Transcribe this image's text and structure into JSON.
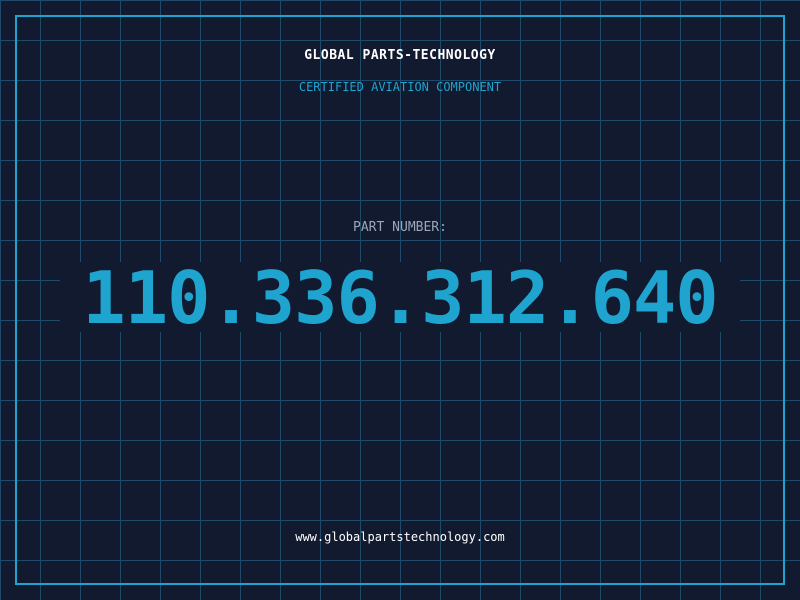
{
  "header": {
    "company": "GLOBAL PARTS-TECHNOLOGY",
    "subtitle": "CERTIFIED AVIATION COMPONENT"
  },
  "part": {
    "label": "PART NUMBER:",
    "number": "110.336.312.640"
  },
  "footer": {
    "url": "www.globalpartstechnology.com"
  },
  "colors": {
    "background": "#111a2e",
    "grid": "#1f4a6a",
    "accent": "#1ea4cf",
    "text": "#ffffff",
    "muted": "#9aa7b8"
  }
}
